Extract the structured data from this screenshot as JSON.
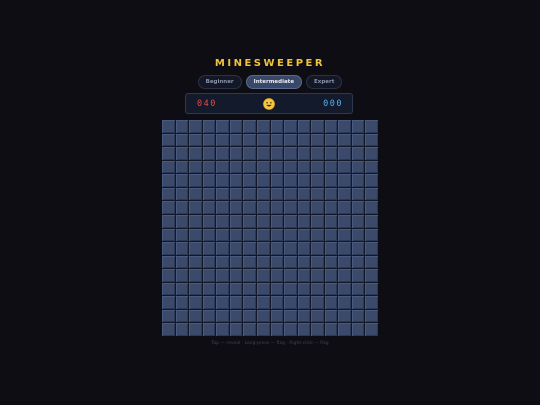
{
  "game": {
    "title": "MINESWEEPER"
  },
  "tabs": [
    {
      "label": "Beginner",
      "active": false
    },
    {
      "label": "Intermediate",
      "active": true
    },
    {
      "label": "Expert",
      "active": false
    }
  ],
  "status": {
    "mines_remaining": "040",
    "timer": "000",
    "face_icon": "smiley-face-icon"
  },
  "board": {
    "rows": 16,
    "cols": 16,
    "state": "all-unrevealed"
  },
  "hint": "Tap — reveal · Long-press — flag · Right-click — flag",
  "colors": {
    "accent": "#f0c43a",
    "mine_counter": "#e84a4a",
    "timer": "#56b4f0",
    "cell": "#3b4a6b",
    "background": "#0e0d14"
  }
}
